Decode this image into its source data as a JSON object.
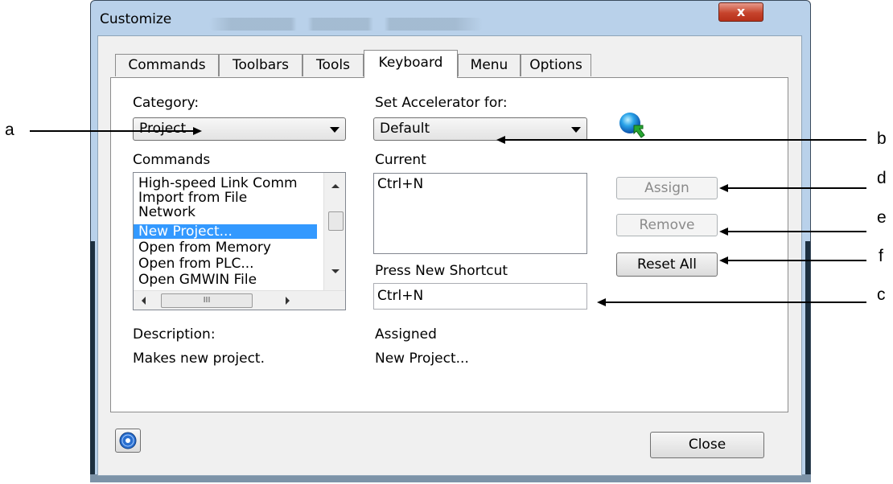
{
  "window": {
    "title": "Customize",
    "close_glyph": "x"
  },
  "tabs": [
    {
      "label": "Commands"
    },
    {
      "label": "Toolbars"
    },
    {
      "label": "Tools"
    },
    {
      "label": "Keyboard",
      "active": true
    },
    {
      "label": "Menu"
    },
    {
      "label": "Options"
    }
  ],
  "category": {
    "label": "Category:",
    "selected": "Project"
  },
  "accelerator": {
    "label": "Set Accelerator for:",
    "selected": "Default"
  },
  "commands": {
    "label": "Commands",
    "items": [
      "High-speed Link Comm",
      "Import from File",
      "Network",
      "New Project...",
      "Open from Memory",
      "Open from PLC...",
      "Open GMWIN File"
    ],
    "selected_index": 3,
    "hscroll_thumb_glyph": "III"
  },
  "current": {
    "label": "Current",
    "items": [
      "Ctrl+N"
    ]
  },
  "shortcut": {
    "label": "Press New Shortcut",
    "value": "Ctrl+N"
  },
  "buttons": {
    "assign": "Assign",
    "remove": "Remove",
    "reset_all": "Reset All",
    "close": "Close"
  },
  "description": {
    "label": "Description:",
    "text": "Makes new project."
  },
  "assigned": {
    "label": "Assigned",
    "text": "New Project..."
  },
  "callouts": {
    "a": "a",
    "b": "b",
    "c": "c",
    "d": "d",
    "e": "e",
    "f": "f"
  },
  "icons": {
    "accelerator": "globe-arrow-icon",
    "help": "help-icon"
  }
}
